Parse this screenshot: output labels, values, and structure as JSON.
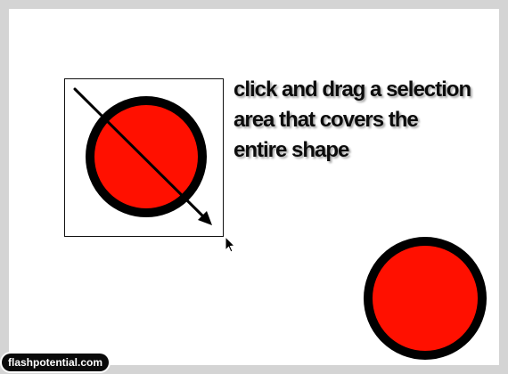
{
  "instruction": {
    "line1": "click and drag a selection",
    "line2": "area that covers the",
    "line3": "entire shape"
  },
  "watermark": "flashpotential.com",
  "colors": {
    "shape_fill": "#ff1000",
    "shape_stroke": "#000000",
    "stage_background": "#ffffff",
    "frame_background": "#d4d4d4"
  },
  "icons": {
    "drag_arrow": "diagonal-arrow-icon",
    "cursor": "mouse-pointer-icon"
  }
}
